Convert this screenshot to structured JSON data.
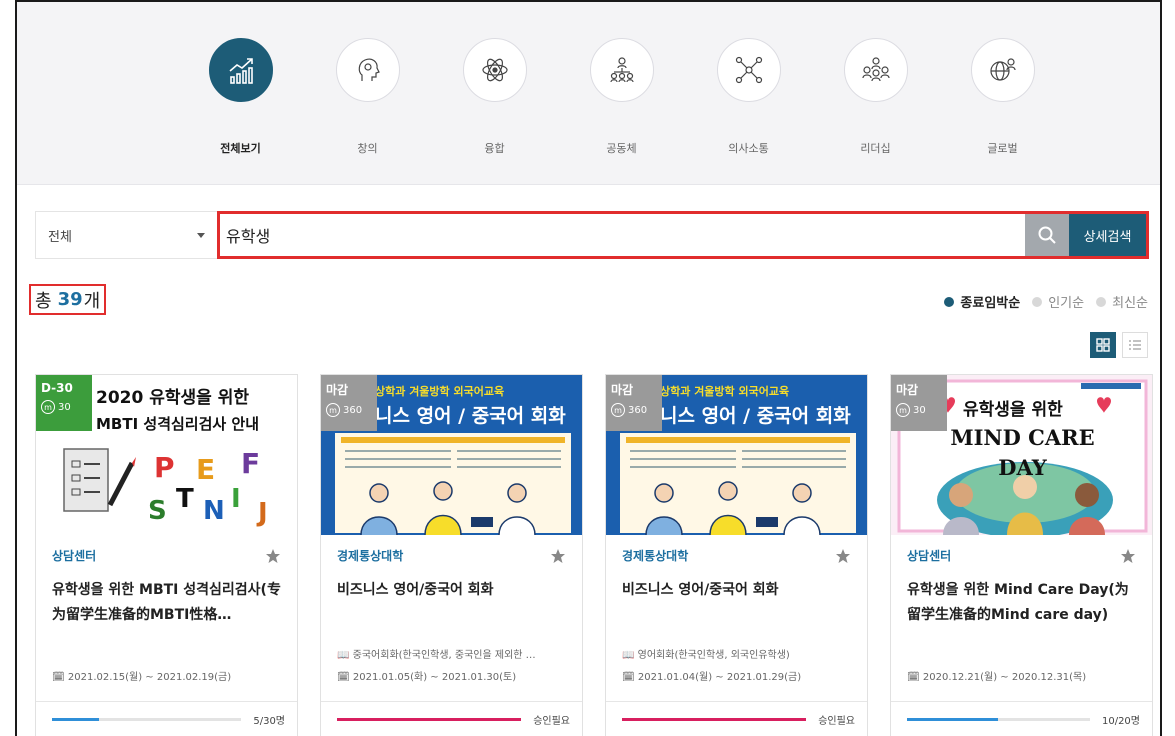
{
  "categories": [
    {
      "label": "전체보기",
      "icon": "chart-growth-icon",
      "active": true
    },
    {
      "label": "창의",
      "icon": "head-gear-icon",
      "active": false
    },
    {
      "label": "융합",
      "icon": "atom-icon",
      "active": false
    },
    {
      "label": "공동체",
      "icon": "people-network-icon",
      "active": false
    },
    {
      "label": "의사소통",
      "icon": "network-nodes-icon",
      "active": false
    },
    {
      "label": "리더십",
      "icon": "team-leader-icon",
      "active": false
    },
    {
      "label": "글로벌",
      "icon": "globe-person-icon",
      "active": false
    }
  ],
  "search": {
    "scope_selected": "전체",
    "query": "유학생",
    "advanced_label": "상세검색"
  },
  "results": {
    "total_prefix": "총",
    "total_count": "39",
    "total_suffix": "개"
  },
  "sort_options": [
    {
      "label": "종료임박순",
      "active": true
    },
    {
      "label": "인기순",
      "active": false
    },
    {
      "label": "최신순",
      "active": false
    }
  ],
  "view_modes": [
    "grid-view-icon",
    "list-view-icon"
  ],
  "cards": [
    {
      "badge_state": "D-30",
      "badge_color": "#3c9d3c",
      "points": "30",
      "thumb_line1": "2020 유학생을 위한",
      "thumb_line2": "MBTI 성격심리검사 안내",
      "org": "상담센터",
      "title": "유학생을 위한 MBTI 성격심리검사(专为留学生准备的MBTI性格…",
      "note": "",
      "dates": "2021.02.15(월) ~ 2021.02.19(금)",
      "progress": 0.25,
      "bar_color": "#2f8fd8",
      "foot_text": "5/30명"
    },
    {
      "badge_state": "마감",
      "badge_color": "#9a9a9a",
      "points": "360",
      "thumb_line1": "상학과 겨울방학 외국어교육",
      "thumb_line2": "니스 영어 / 중국어 회화",
      "org": "경제통상대학",
      "title": "비즈니스 영어/중국어 회화",
      "note": "중국어회화(한국인학생, 중국인을 제외한 …",
      "dates": "2021.01.05(화) ~ 2021.01.30(토)",
      "progress": 1.0,
      "bar_color": "#d81f5f",
      "foot_text": "승인필요"
    },
    {
      "badge_state": "마감",
      "badge_color": "#9a9a9a",
      "points": "360",
      "thumb_line1": "상학과 겨울방학 외국어교육",
      "thumb_line2": "니스 영어 / 중국어 회화",
      "org": "경제통상대학",
      "title": "비즈니스 영어/중국어 회화",
      "note": "영어회화(한국인학생, 외국인유학생)",
      "dates": "2021.01.04(월) ~ 2021.01.29(금)",
      "progress": 1.0,
      "bar_color": "#d81f5f",
      "foot_text": "승인필요"
    },
    {
      "badge_state": "마감",
      "badge_color": "#9a9a9a",
      "points": "30",
      "thumb_line1": "유학생을 위한",
      "thumb_line2": "MIND CARE",
      "thumb_line3": "DAY",
      "org": "상담센터",
      "title": "유학생을 위한 Mind Care Day(为留学生准备的Mind care day)",
      "note": "",
      "dates": "2020.12.21(월) ~ 2020.12.31(목)",
      "progress": 0.5,
      "bar_color": "#2f8fd8",
      "foot_text": "10/20명"
    }
  ]
}
